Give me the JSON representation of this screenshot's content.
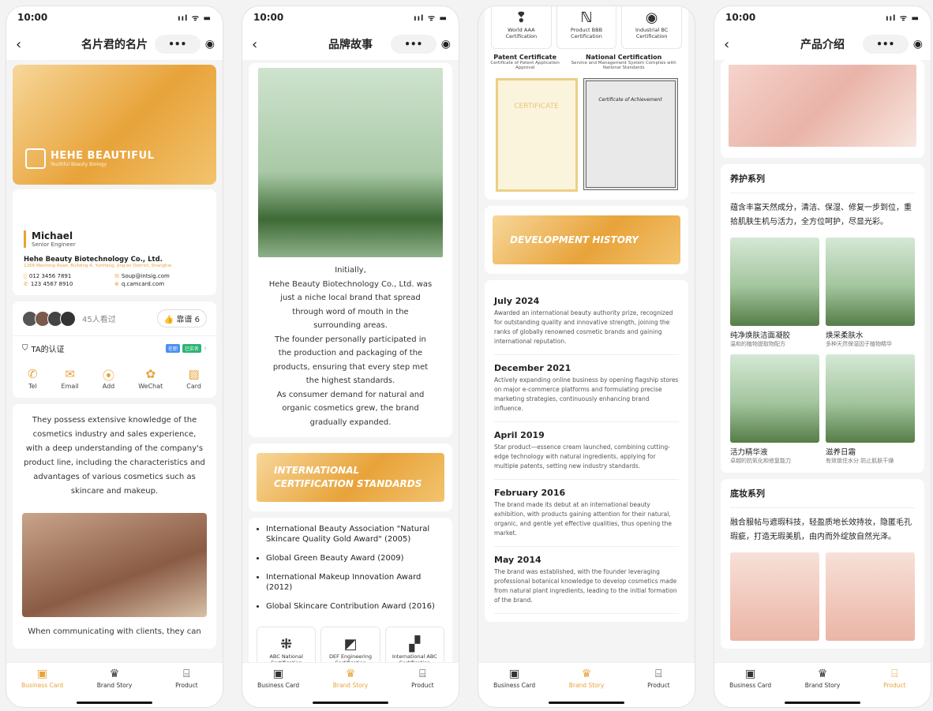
{
  "status": {
    "time": "10:00",
    "signal": "ııl ᯤ ▬"
  },
  "nav": {
    "back": "‹",
    "caps_more": "•••",
    "caps_close": "◉"
  },
  "tabs": [
    {
      "label": "Business Card"
    },
    {
      "label": "Brand Story"
    },
    {
      "label": "Product"
    }
  ],
  "accent": "#e8a33a",
  "phone1": {
    "title": "名片君的名片",
    "brand": {
      "name": "HEHE BEAUTIFUL",
      "sub": "Youthful Beauty Biology"
    },
    "person": {
      "name": "Michael",
      "title": "Senior Engineer"
    },
    "company": "Hehe Beauty Biotechnology Co., Ltd.",
    "address": "1268 Wanrong Road, Building A, Yuntfang, Jing'an District, Shanghai",
    "phone1": "012 3456 7891",
    "email": "Soup@intsig.com",
    "phone2": "123 4567 8910",
    "web": "q.camcard.com",
    "views": "45人看过",
    "like": "👍 靠谱 6",
    "cert": "TA的认证",
    "badge1": "在职",
    "badge2": "已实名",
    "actions": [
      {
        "label": "Tel",
        "icon": "✆"
      },
      {
        "label": "Email",
        "icon": "✉"
      },
      {
        "label": "Add",
        "icon": "⦿"
      },
      {
        "label": "WeChat",
        "icon": "✿"
      },
      {
        "label": "Card",
        "icon": "▨"
      }
    ],
    "description": "They possess extensive knowledge of the cosmetics industry and sales experience, with a deep understanding of the company's product line, including the characteristics and advantages of various cosmetics such as skincare and makeup.",
    "more": "When communicating with clients, they can"
  },
  "phone2": {
    "title": "品牌故事",
    "story": "Initially,\nHehe Beauty Biotechnology Co., Ltd. was just a niche local brand that spread through word of mouth in the surrounding areas.\nThe founder personally participated in the production and packaging of the products, ensuring that every step met the highest standards.\nAs consumer demand for natural and organic cosmetics grew, the brand gradually expanded.",
    "ribbon1": "INTERNATIONAL",
    "ribbon2": "CERTIFICATION STANDARDS",
    "awards": [
      "International Beauty Association \"Natural Skincare Quality Gold Award\" (2005)",
      "Global Green Beauty Award (2009)",
      "International Makeup Innovation Award (2012)",
      "Global Skincare Contribution Award (2016)"
    ],
    "certs": [
      {
        "name": "ABC National Certification",
        "icon": "⁜"
      },
      {
        "name": "DEF Engineering Certification",
        "icon": "◩"
      },
      {
        "name": "International ABC Certification",
        "icon": "▞"
      }
    ]
  },
  "phone3": {
    "certs": [
      {
        "name": "World AAA Certification",
        "icon": "❢"
      },
      {
        "name": "Product BBB Certification",
        "icon": "ℕ"
      },
      {
        "name": "Industrial BC Certification",
        "icon": "◉"
      }
    ],
    "patent": {
      "title": "Patent Certificate",
      "sub": "Certificate of Patent Application Approval"
    },
    "national": {
      "title": "National Certification",
      "sub": "Service and Management System Complies with National Standards"
    },
    "cert_img1": "CERTIFICATE",
    "cert_img2": "Certificate of Achievement",
    "ribbon": "DEVELOPMENT HISTORY",
    "history": [
      {
        "date": "July 2024",
        "text": "Awarded an international beauty authority prize, recognized for outstanding quality and innovative strength, joining the ranks of globally renowned cosmetic brands and gaining international reputation."
      },
      {
        "date": "December 2021",
        "text": "Actively expanding online business by opening flagship stores on major e-commerce platforms and formulating precise marketing strategies, continuously enhancing brand influence."
      },
      {
        "date": "April 2019",
        "text": "Star product—essence cream launched, combining cutting-edge technology with natural ingredients, applying for multiple patents, setting new industry standards."
      },
      {
        "date": "February 2016",
        "text": "The brand made its debut at an international beauty exhibition, with products gaining attention for their natural, organic, and gentle yet effective qualities, thus opening the market."
      },
      {
        "date": "May 2014",
        "text": "The brand was established, with the founder leveraging professional botanical knowledge to develop cosmetics made from natural plant ingredients, leading to the initial formation of the brand."
      }
    ]
  },
  "phone4": {
    "title": "产品介绍",
    "sec1": {
      "title": "养护系列",
      "desc": "蕴含丰富天然成分，清洁、保湿、修复一步到位，重拾肌肤生机与活力，全方位呵护，尽显光彩。",
      "items": [
        {
          "name": "纯净焕肤洁面凝胶",
          "sub": "温和的植物提取物配方"
        },
        {
          "name": "焕采柔肤水",
          "sub": "多种天然保湿因子植物精华"
        },
        {
          "name": "活力精华液",
          "sub": "卓越的抗氧化和修复能力"
        },
        {
          "name": "滋养日霜",
          "sub": "有效锁住水分 防止肌肤干燥"
        }
      ]
    },
    "sec2": {
      "title": "底妆系列",
      "desc": "融合服帖与遮瑕科技，轻盈质地长效持妆，隐匿毛孔瑕疵，打造无瑕美肌，由内而外绽放自然光泽。"
    }
  }
}
